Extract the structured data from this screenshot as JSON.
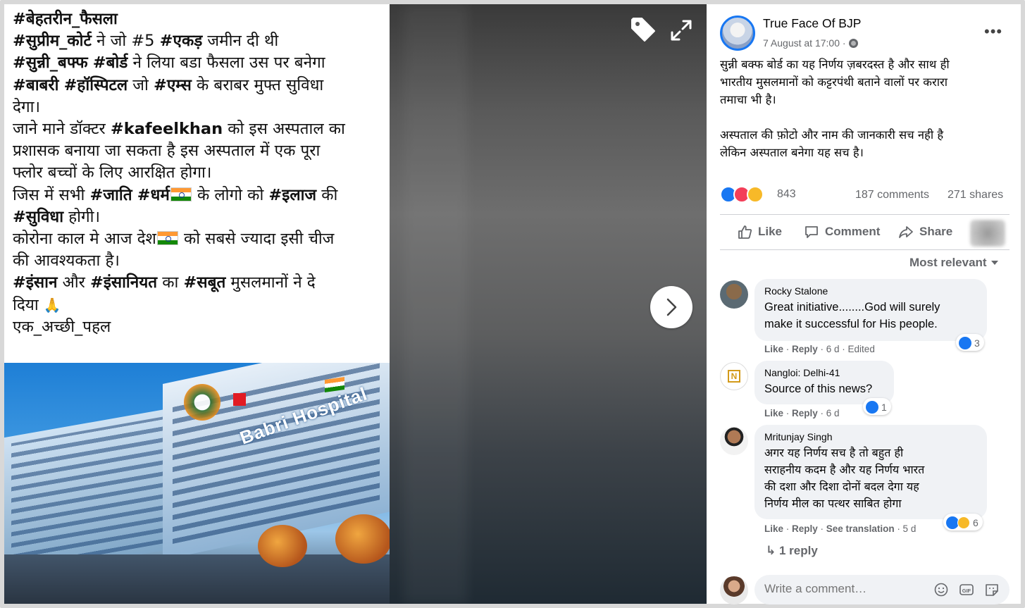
{
  "post_image": {
    "lines": [
      [
        {
          "t": "#बेहतरीन_फैसला",
          "b": true
        }
      ],
      [
        {
          "t": "#सुप्रीम_कोर्ट",
          "b": true
        },
        {
          "t": " ने जो "
        },
        {
          "t": "#5 "
        },
        {
          "t": "#एकड़",
          "b": true
        },
        {
          "t": " जमीन दी थी"
        }
      ],
      [
        {
          "t": "#सुन्नी_बफ्फ",
          "b": true
        },
        {
          "t": " "
        },
        {
          "t": "#बोर्ड",
          "b": true
        },
        {
          "t": " ने लिया बडा फैसला उस पर बनेगा"
        }
      ],
      [
        {
          "t": "#बाबरी",
          "b": true
        },
        {
          "t": " "
        },
        {
          "t": "#हॉस्पिटल",
          "b": true
        },
        {
          "t": " जो "
        },
        {
          "t": "#एम्स",
          "b": true
        },
        {
          "t": " के बराबर  मुफ्त सुविधा"
        }
      ],
      [
        {
          "t": "देगा।"
        }
      ],
      [
        {
          "t": "जाने माने डॉक्टर "
        },
        {
          "t": "#kafeelkhan",
          "b": true
        },
        {
          "t": " को इस अस्पताल का"
        }
      ],
      [
        {
          "t": "प्रशासक बनाया जा सकता है इस अस्पताल में एक पूरा"
        }
      ],
      [
        {
          "t": "फ्लोर बच्चों के लिए आरक्षित होगा।"
        }
      ],
      [
        {
          "t": " "
        }
      ],
      [
        {
          "t": "जिस में सभी "
        },
        {
          "t": "#जाति",
          "b": true
        },
        {
          "t": " "
        },
        {
          "t": "#धर्म",
          "b": true
        },
        {
          "flag": true
        },
        {
          "t": " के लोगो को "
        },
        {
          "t": "#इलाज",
          "b": true
        },
        {
          "t": " की"
        }
      ],
      [
        {
          "t": "#सुविधा",
          "b": true
        },
        {
          "t": " होगी।"
        }
      ],
      [
        {
          "t": "कोरोना काल मे आज देश"
        },
        {
          "flag": true
        },
        {
          "t": " को सबसे ज्यादा इसी चीज"
        }
      ],
      [
        {
          "t": "की आवश्यकता है।"
        }
      ],
      [
        {
          "t": "#इंसान",
          "b": true
        },
        {
          "t": " और "
        },
        {
          "t": "#इंसानियत",
          "b": true
        },
        {
          "t": " का "
        },
        {
          "t": "#सबूत",
          "b": true
        },
        {
          "t": " मुसलमानों ने दे"
        }
      ],
      [
        {
          "t": "दिया "
        },
        {
          "pray": true
        }
      ],
      [
        {
          "t": "एक_अच्छी_पहल"
        }
      ]
    ],
    "sign_text": "Babri Hospital"
  },
  "post": {
    "page_name": "True Face Of BJP",
    "time": "7 August at 17:00 ·",
    "caption": "सुन्नी बक्फ बोर्ड का यह निर्णय ज़बरदस्त है और साथ ही\nभारतीय मुसलमानों को कट्टरपंथी बताने वालों पर करारा\nतमाचा भी है।\n\nअस्पताल की फ़ोटो और नाम की जानकारी सच नही है\nलेकिन अस्पताल बनेगा यह सच है।",
    "reaction_count": "843",
    "comments_count": "187 comments",
    "shares_count": "271 shares",
    "actions": {
      "like": "Like",
      "comment": "Comment",
      "share": "Share"
    },
    "sort_label": "Most relevant"
  },
  "comments": [
    {
      "name": "Rocky Stalone",
      "text": "Great initiative........God will surely\nmake it successful for His people.",
      "like": "Like",
      "reply": "Reply",
      "meta_rest": " · 6 d · Edited",
      "reactions": "3"
    },
    {
      "name": "Nangloi: Delhi-41",
      "text": "Source of this news?",
      "like": "Like",
      "reply": "Reply",
      "meta_rest": " · 6 d",
      "reactions": "1",
      "avatar_text": "N"
    },
    {
      "name": "Mritunjay Singh",
      "text": "अगर यह निर्णय सच है तो बहुत ही\nसराहनीय कदम है और यह निर्णय भारत\nकी दशा और दिशा दोनों बदल देगा यह\nनिर्णय मील का पत्थर साबित होगा",
      "like": "Like",
      "reply": "Reply",
      "see_translation": "See translation",
      "meta_rest": " · 5 d",
      "reactions": "6"
    }
  ],
  "replies_link": "1 reply",
  "composer": {
    "placeholder": "Write a comment…"
  },
  "icons": {
    "tag": "tag-icon",
    "expand": "expand-icon",
    "next": "chevron-right-icon",
    "more": "more-icon",
    "globe": "globe-icon",
    "emoji": "emoji-icon",
    "gif": "gif-icon",
    "sticker": "sticker-icon"
  },
  "colors": {
    "fb_blue": "#1877f2",
    "love": "#f33e58",
    "haha": "#f7b928",
    "meta_gray": "#65676b",
    "bubble": "#f0f2f5"
  }
}
